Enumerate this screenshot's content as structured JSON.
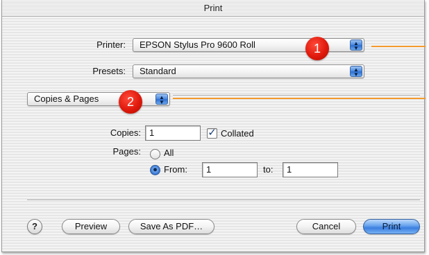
{
  "window": {
    "title": "Print"
  },
  "printer": {
    "label": "Printer:",
    "value": "EPSON Stylus Pro 9600 Roll"
  },
  "presets": {
    "label": "Presets:",
    "value": "Standard"
  },
  "panel": {
    "value": "Copies & Pages"
  },
  "badges": {
    "one": "1",
    "two": "2"
  },
  "copies": {
    "label": "Copies:",
    "value": "1",
    "collated_label": "Collated",
    "collated_checked": true
  },
  "pages": {
    "label": "Pages:",
    "all_label": "All",
    "from_label": "From:",
    "from_value": "1",
    "to_label": "to:",
    "to_value": "1",
    "selected": "from"
  },
  "buttons": {
    "help": "?",
    "preview": "Preview",
    "save_pdf": "Save As PDF…",
    "cancel": "Cancel",
    "print": "Print"
  },
  "icons": {
    "popup": "up-down-arrows-icon",
    "check": "checkmark-icon",
    "help": "question-mark-icon"
  },
  "colors": {
    "callout_badge": "#e01a0c",
    "callout_line": "#f39a2b",
    "aqua_blue": "#3c7fe0"
  }
}
